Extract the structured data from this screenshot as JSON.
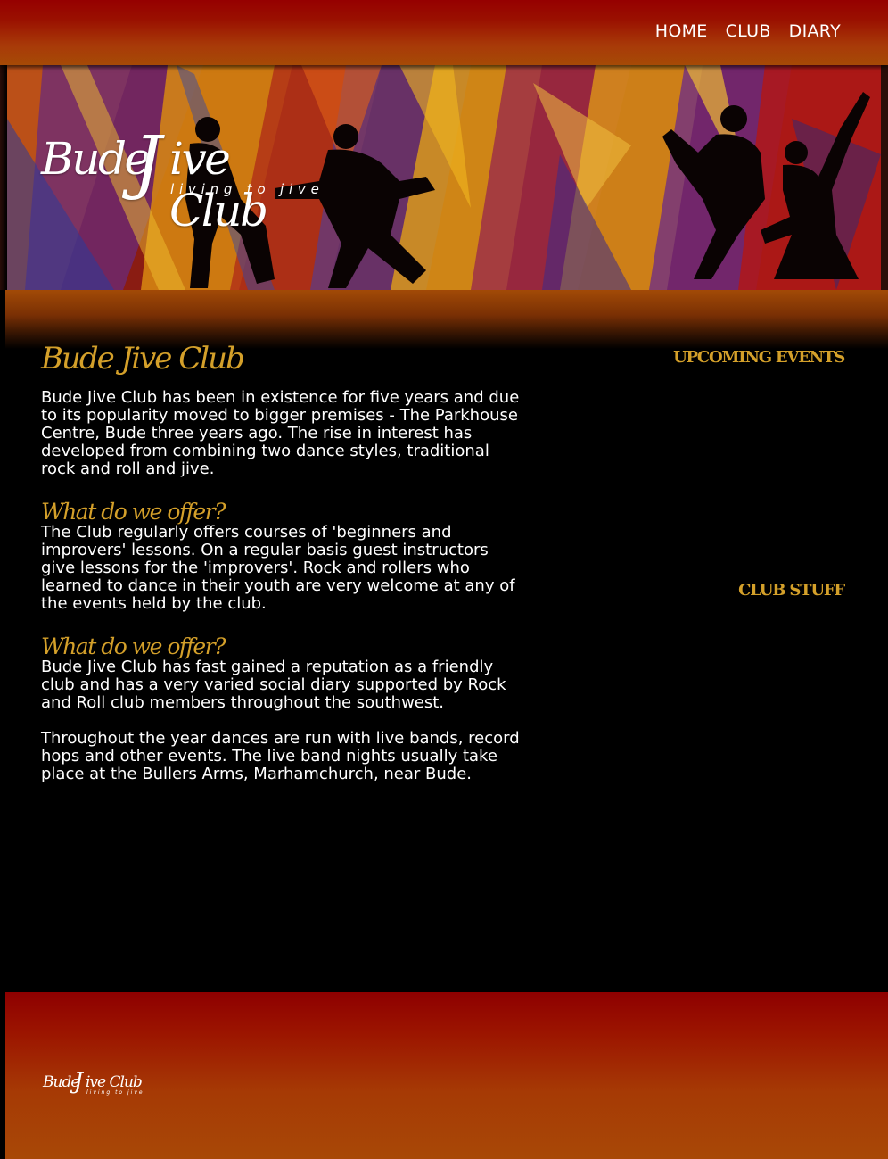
{
  "nav": {
    "items": [
      {
        "label": "HOME"
      },
      {
        "label": "CLUB"
      },
      {
        "label": "DIARY"
      }
    ]
  },
  "logo": {
    "word1": "Bude",
    "j": "J",
    "word2": "ive Club",
    "tagline": "living to jive"
  },
  "main": {
    "title": "Bude Jive Club",
    "intro": "Bude Jive Club has been in existence for five years and due to its popularity moved to bigger premises - The Parkhouse Centre, Bude three years ago. The rise in interest has developed from combining two dance styles, traditional rock and roll and jive.",
    "sections": [
      {
        "heading": "What do we offer?",
        "paragraphs": [
          "The Club regularly offers courses of 'beginners and improvers' lessons. On a regular basis guest instructors give lessons for the 'improvers'. Rock and rollers who learned to dance in their youth are very welcome at any of the events held by the club."
        ]
      },
      {
        "heading": "What do we offer?",
        "paragraphs": [
          "Bude Jive Club has fast gained a reputation as a friendly club and has a very varied social diary supported by Rock and Roll club members throughout the southwest.",
          "Throughout the year dances are run with live bands, record hops and other events. The live band nights usually take place at the Bullers Arms, Marhamchurch, near Bude."
        ]
      }
    ]
  },
  "sidebar": {
    "upcoming_heading": "UPCOMING EVENTS",
    "club_heading": "CLUB STUFF"
  },
  "colors": {
    "accent": "#d4a02a",
    "nav_bar": "#9a1000",
    "footer": "#a63a05",
    "background": "#000000"
  }
}
